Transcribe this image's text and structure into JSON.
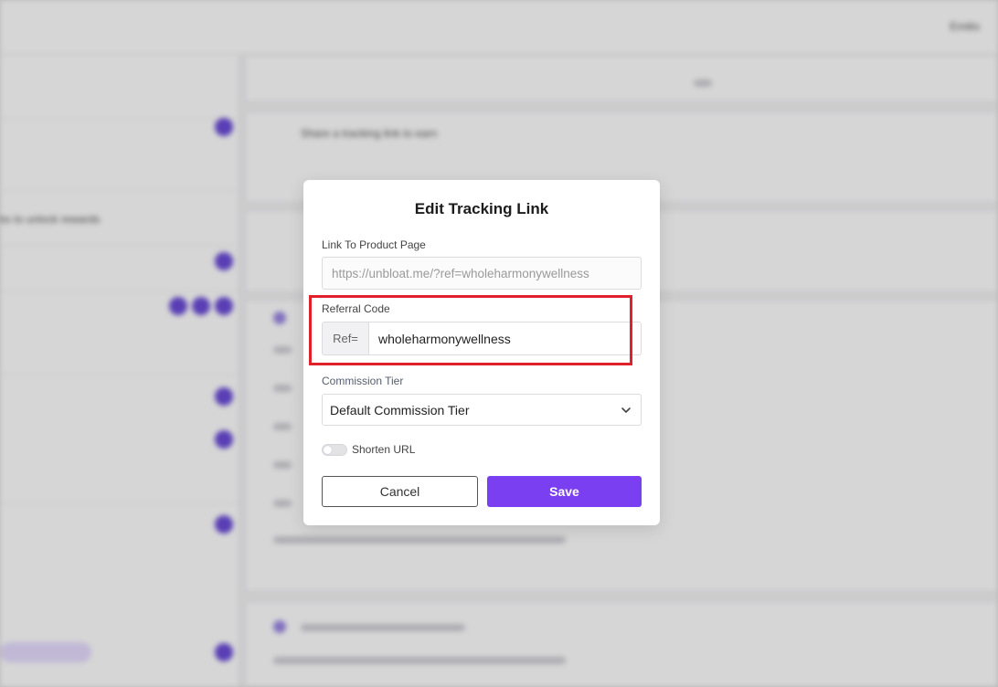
{
  "background": {
    "topbar_user": "Emilio",
    "sidebar_text_1": "ks to unlock rewards",
    "main_text_1": "Share a tracking link to earn"
  },
  "modal": {
    "title": "Edit Tracking Link",
    "product_link": {
      "label": "Link To Product Page",
      "value": "https://unbloat.me/?ref=wholeharmonywellness"
    },
    "referral": {
      "label": "Referral Code",
      "prefix": "Ref=",
      "value": "wholeharmonywellness"
    },
    "commission": {
      "label": "Commission Tier",
      "selected": "Default Commission Tier"
    },
    "shorten": {
      "label": "Shorten URL",
      "enabled": false
    },
    "cancel_label": "Cancel",
    "save_label": "Save"
  },
  "colors": {
    "accent": "#7b3ff2",
    "highlight": "#e0202b"
  },
  "icons": {
    "select_chevron": "chevron-down-icon"
  }
}
